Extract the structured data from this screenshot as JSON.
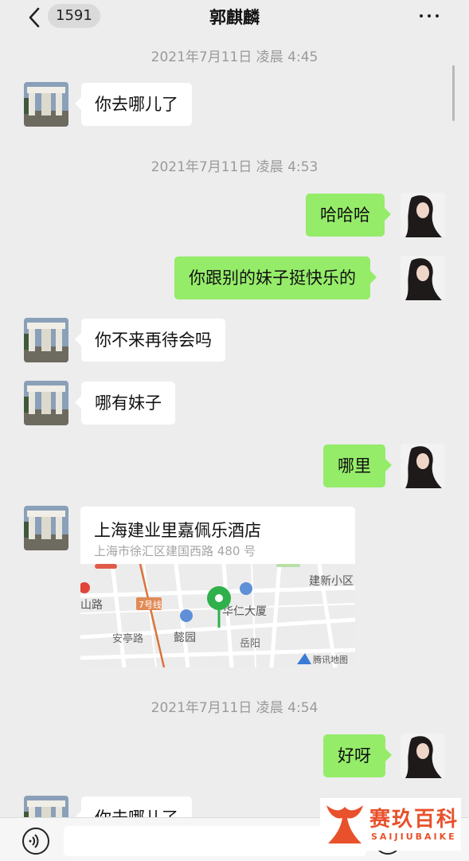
{
  "header": {
    "back_icon": "chevron-left-icon",
    "unread_count": "1591",
    "title": "郭麒麟",
    "more_icon": "more-dots-icon"
  },
  "messages": [
    {
      "type": "timestamp",
      "text": "2021年7月11日 凌晨 4:45"
    },
    {
      "type": "text",
      "side": "left",
      "text": "你去哪儿了"
    },
    {
      "type": "timestamp",
      "text": "2021年7月11日 凌晨 4:53"
    },
    {
      "type": "text",
      "side": "right",
      "text": "哈哈哈"
    },
    {
      "type": "text",
      "side": "right",
      "text": "你跟别的妹子挺快乐的"
    },
    {
      "type": "text",
      "side": "left",
      "text": "你不来再待会吗"
    },
    {
      "type": "text",
      "side": "left",
      "text": "哪有妹子"
    },
    {
      "type": "text",
      "side": "right",
      "text": "哪里"
    },
    {
      "type": "location",
      "side": "left",
      "name": "上海建业里嘉佩乐酒店",
      "address": "上海市徐汇区建国西路 480 号",
      "map_labels": {
        "district": "建新小区",
        "road_left": "山路",
        "metro": "7号线",
        "building": "华仁大厦",
        "park": "懿园",
        "road_an": "安亭路",
        "road_yue": "岳阳",
        "provider": "腾讯地图"
      }
    },
    {
      "type": "timestamp",
      "text": "2021年7月11日 凌晨 4:54"
    },
    {
      "type": "text",
      "side": "right",
      "text": "好呀"
    },
    {
      "type": "text",
      "side": "left",
      "text": "你去哪儿了"
    }
  ],
  "input_bar": {
    "voice_icon": "voice-icon",
    "emoji_icon": "emoji-icon"
  },
  "watermark": {
    "name_cn": "赛玖百科",
    "name_en": "SAIJIUBAIKE"
  },
  "colors": {
    "background": "#ededed",
    "bubble_right": "#95ec69",
    "bubble_left": "#ffffff",
    "timestamp": "#9a9a9a",
    "watermark": "#e8512b"
  }
}
